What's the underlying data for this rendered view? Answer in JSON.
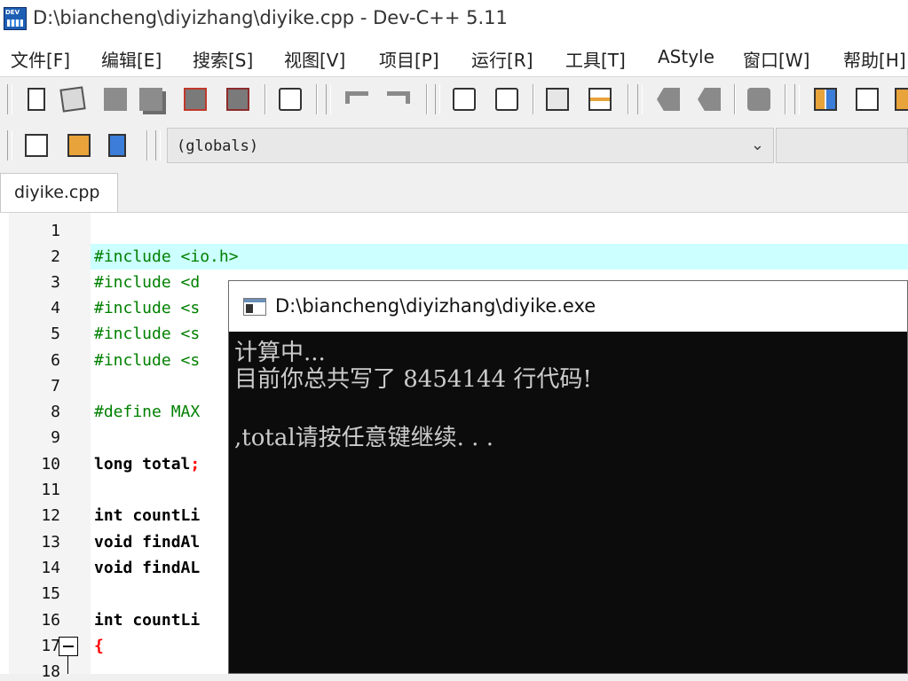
{
  "window": {
    "title": "D:\\biancheng\\diyizhang\\diyike.cpp - Dev-C++ 5.11"
  },
  "menu": [
    "文件[F]",
    "编辑[E]",
    "搜索[S]",
    "视图[V]",
    "项目[P]",
    "运行[R]",
    "工具[T]",
    "AStyle",
    "窗口[W]",
    "帮助[H]"
  ],
  "scope_select": {
    "value": "(globals)"
  },
  "tab": {
    "label": "diyike.cpp"
  },
  "editor": {
    "line_numbers": [
      "1",
      "2",
      "3",
      "4",
      "5",
      "6",
      "7",
      "8",
      "9",
      "10",
      "11",
      "12",
      "13",
      "14",
      "15",
      "16",
      "17",
      "18"
    ],
    "lines": [
      "",
      "#include <io.h>",
      "#include <d",
      "#include <s",
      "#include <s",
      "#include <s",
      "",
      "#define MAX",
      "",
      "long total",
      "",
      "int countLi",
      "void findAl",
      "void findAL",
      "",
      "int countLi",
      "{",
      ""
    ],
    "semicolon": ";",
    "highlight_color": "#ccffff"
  },
  "console": {
    "title": "D:\\biancheng\\diyizhang\\diyike.exe",
    "lines": [
      "计算中...",
      "目前你总共写了 8454144 行代码!",
      "",
      ",total请按任意键继续. . ."
    ]
  },
  "colors": {
    "preprocessor": "#008000",
    "keyword": "#000000",
    "brace": "#ff0000",
    "console_bg": "#0c0c0c",
    "console_fg": "#cccccc"
  }
}
